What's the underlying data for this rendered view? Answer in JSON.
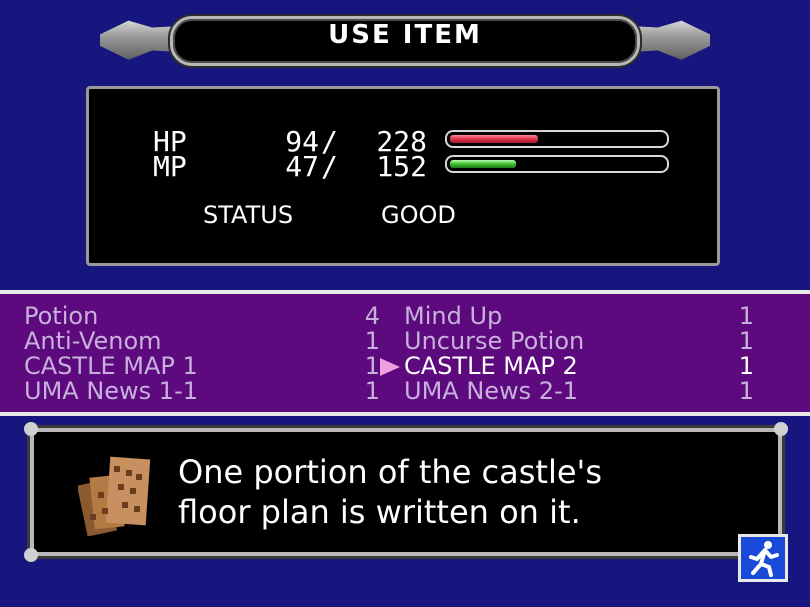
{
  "header": {
    "title": "USE ITEM"
  },
  "stats": {
    "hp": {
      "label": "HP",
      "current": "94",
      "slash": "/",
      "max": "228",
      "fraction": 0.412
    },
    "mp": {
      "label": "MP",
      "current": "47",
      "slash": "/",
      "max": "152",
      "fraction": 0.309
    },
    "status_label": "STATUS",
    "status_value": "GOOD"
  },
  "items": {
    "left": [
      {
        "name": "Potion",
        "qty": "4"
      },
      {
        "name": "Anti-Venom",
        "qty": "1"
      },
      {
        "name": "CASTLE MAP 1",
        "qty": "1"
      },
      {
        "name": "UMA News 1-1",
        "qty": "1"
      }
    ],
    "right": [
      {
        "name": "Mind Up",
        "qty": "1"
      },
      {
        "name": "Uncurse Potion",
        "qty": "1"
      },
      {
        "name": "CASTLE MAP 2",
        "qty": "1",
        "selected": true
      },
      {
        "name": "UMA News 2-1",
        "qty": "1"
      }
    ]
  },
  "description": {
    "icon": "castle-map-icon",
    "text": "One portion of the castle's\nfloor plan is written on it."
  },
  "exit": {
    "icon": "running-man-icon"
  },
  "colors": {
    "background": "#16167e",
    "list_background": "#5c0a7e",
    "hp_bar": "#e0304a",
    "mp_bar": "#40c030",
    "cursor": "#f0a0e0"
  }
}
